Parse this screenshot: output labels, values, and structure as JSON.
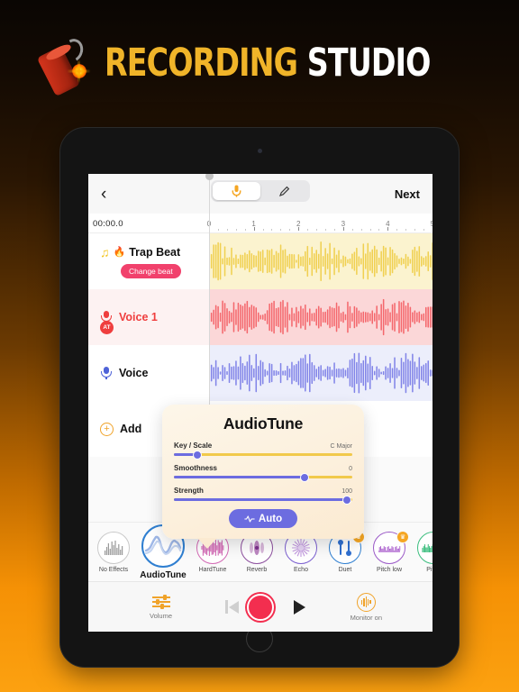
{
  "promo": {
    "title_word1": "RECORDING",
    "title_word2": "STUDIO",
    "icon": "dynamite-icon"
  },
  "app": {
    "topbar": {
      "back_icon": "chevron-left-icon",
      "back_label": "‹",
      "segments": [
        {
          "id": "record",
          "icon": "microphone-icon",
          "glyph": "🎤",
          "active": true
        },
        {
          "id": "edit",
          "icon": "pencil-icon",
          "glyph": "✎",
          "active": false
        }
      ],
      "next_label": "Next"
    },
    "ruler": {
      "timecode": "00:00.0",
      "ticks": [
        "0",
        "1",
        "2",
        "3",
        "4",
        "5"
      ],
      "playhead_position": "0"
    },
    "tracks": [
      {
        "id": "trap-beat",
        "icon": "music-note-icon",
        "emoji": "🔥",
        "name": "Trap Beat",
        "chip_label": "Change beat",
        "badge": null,
        "name_color": "#111111",
        "wave_color": "#f0d050",
        "bg_color": "#fbf3cf"
      },
      {
        "id": "voice-1",
        "icon": "microphone-icon",
        "emoji": "",
        "name": "Voice 1",
        "chip_label": null,
        "badge": "AT",
        "name_color": "#ef3e3e",
        "wave_color": "#f4676c",
        "bg_color": "#fbd7d8"
      },
      {
        "id": "voice-2",
        "icon": "microphone-icon",
        "emoji": "",
        "name": "Voice",
        "chip_label": null,
        "badge": null,
        "name_color": "#111111",
        "wave_color": "#8184e8",
        "bg_color": "#eceefb"
      },
      {
        "id": "add-track",
        "icon": "plus-circle-icon",
        "emoji": "",
        "name": "Add",
        "chip_label": null,
        "badge": null,
        "name_color": "#111111",
        "wave_color": null,
        "bg_color": "#ffffff"
      }
    ],
    "popup": {
      "title": "AudioTune",
      "sliders": [
        {
          "label": "Key / Scale",
          "value": "C Major",
          "percent": 13
        },
        {
          "label": "Smoothness",
          "value": "0",
          "percent": 73
        },
        {
          "label": "Strength",
          "value": "100",
          "percent": 97
        }
      ],
      "auto_label": "Auto",
      "auto_icon": "waveform-icon"
    },
    "effects": [
      {
        "id": "no-effects",
        "label": "No Effects",
        "ring": "#c9c9c9",
        "selected": false,
        "badge": null
      },
      {
        "id": "audiotune",
        "label": "AudioTune",
        "ring": "#2f7fd1",
        "selected": true,
        "badge": "gear"
      },
      {
        "id": "hardtune",
        "label": "HardTune",
        "ring": "#d36ab5",
        "selected": false,
        "badge": null
      },
      {
        "id": "reverb",
        "label": "Reverb",
        "ring": "#8d4f9e",
        "selected": false,
        "badge": null
      },
      {
        "id": "echo",
        "label": "Echo",
        "ring": "#7b5fd0",
        "selected": false,
        "badge": null
      },
      {
        "id": "duet",
        "label": "Duet",
        "ring": "#2f7fd1",
        "selected": false,
        "badge": "crown"
      },
      {
        "id": "pitch-low",
        "label": "Pitch low",
        "ring": "#9b59c7",
        "selected": false,
        "badge": "crown"
      },
      {
        "id": "pitch",
        "label": "Pitch",
        "ring": "#3bbd7e",
        "selected": false,
        "badge": null
      }
    ],
    "transport": {
      "volume_label": "Volume",
      "volume_icon": "sliders-icon",
      "prev_icon": "skip-to-start-icon",
      "record_icon": "record-button-icon",
      "play_icon": "play-icon",
      "monitor_label": "Monitor on",
      "monitor_icon": "monitor-icon"
    }
  },
  "colors": {
    "accent_orange": "#f0a32a",
    "brand_yellow": "#f0b429",
    "record_red": "#f32e4f",
    "chip_pink": "#f1416c",
    "slider_purple": "#6c6ce0",
    "slider_track": "#f1c94b"
  }
}
